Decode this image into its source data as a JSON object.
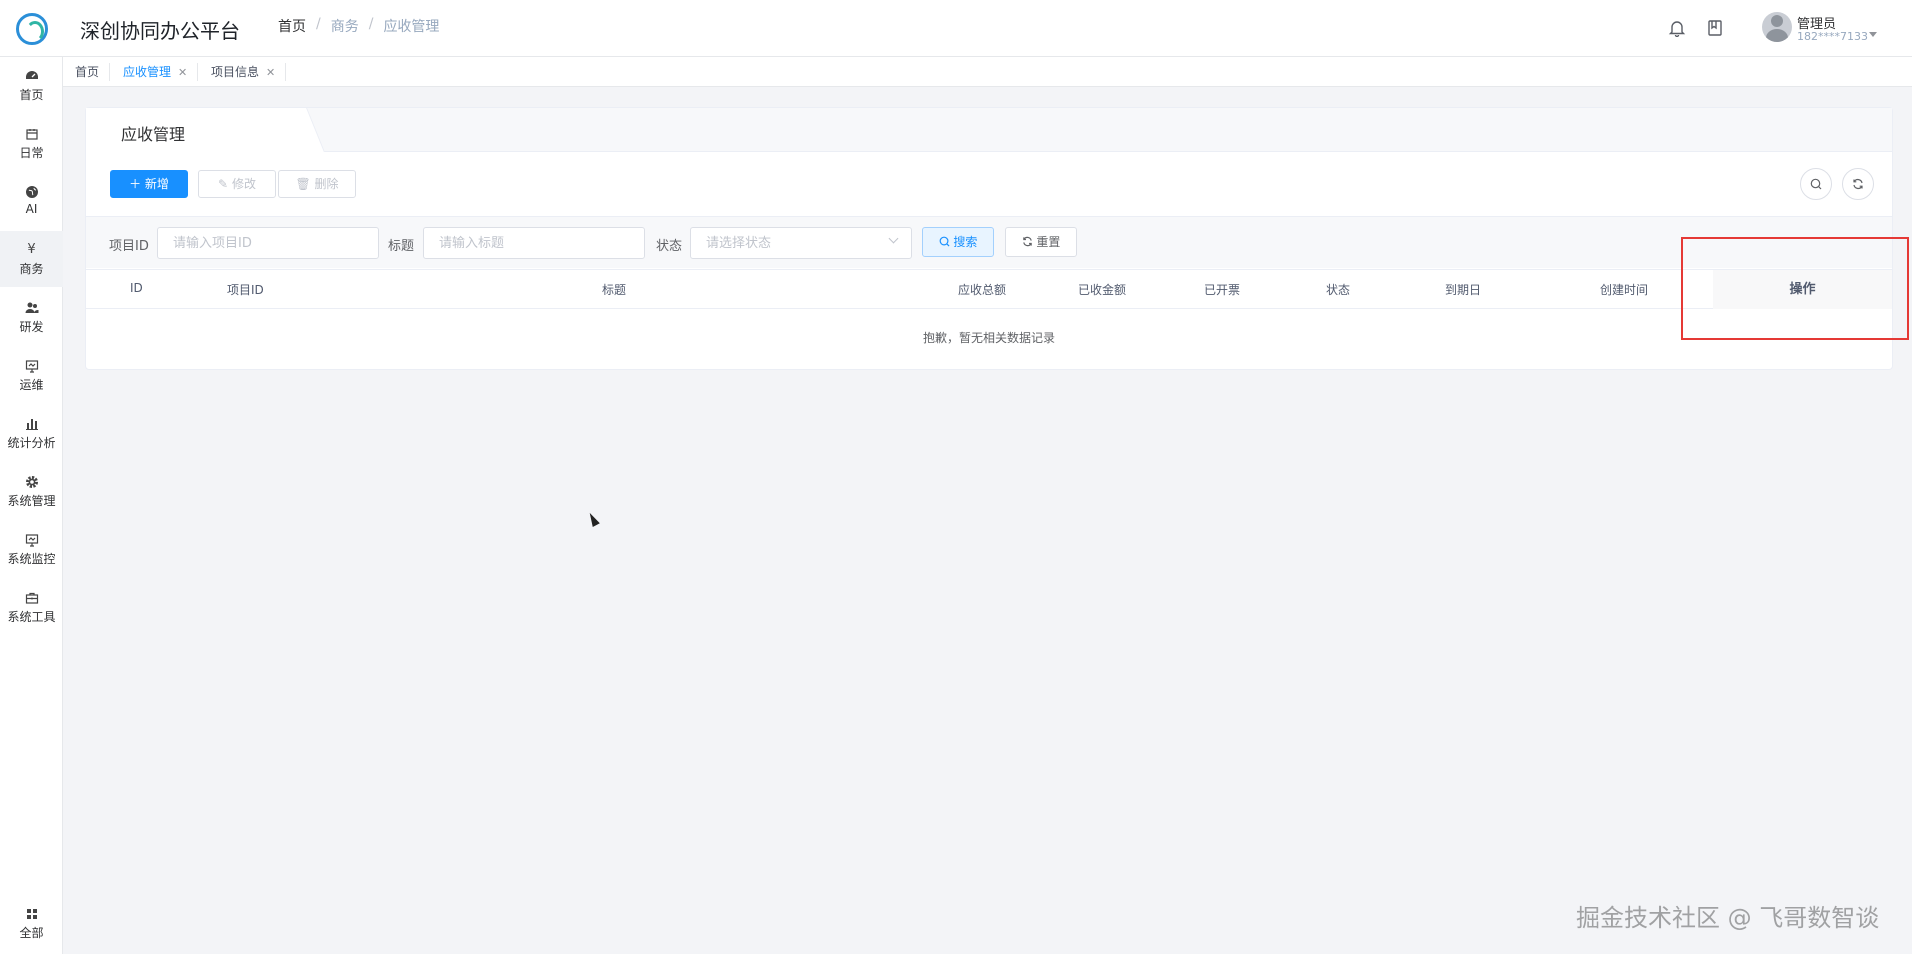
{
  "header": {
    "app_title": "深创协同办公平台",
    "breadcrumb": [
      "首页",
      "商务",
      "应收管理"
    ],
    "user": {
      "name": "管理员",
      "phone": "182****7133"
    },
    "icons": [
      "bell-icon",
      "book-icon"
    ]
  },
  "sidebar": {
    "items": [
      {
        "label": "首页",
        "icon": "dashboard-icon"
      },
      {
        "label": "日常",
        "icon": "calendar-icon"
      },
      {
        "label": "AI",
        "icon": "globe-icon"
      },
      {
        "label": "商务",
        "icon": "yen-icon"
      },
      {
        "label": "研发",
        "icon": "users-icon"
      },
      {
        "label": "运维",
        "icon": "monitor-icon"
      },
      {
        "label": "统计分析",
        "icon": "chart-icon"
      },
      {
        "label": "系统管理",
        "icon": "gear-icon"
      },
      {
        "label": "系统监控",
        "icon": "monitor-icon"
      },
      {
        "label": "系统工具",
        "icon": "toolbox-icon"
      }
    ],
    "bottom": {
      "label": "全部",
      "icon": "grid-icon"
    },
    "active": "商务"
  },
  "tags": [
    {
      "label": "首页",
      "closable": false
    },
    {
      "label": "应收管理",
      "closable": true,
      "active": true
    },
    {
      "label": "项目信息",
      "closable": true
    }
  ],
  "card": {
    "tab_label": "应收管理",
    "toolbar": {
      "add_label": "新增",
      "edit_label": "修改",
      "delete_label": "删除"
    },
    "filters": {
      "project_id_label": "项目ID",
      "project_id_placeholder": "请输入项目ID",
      "title_label": "标题",
      "title_placeholder": "请输入标题",
      "status_label": "状态",
      "status_placeholder": "请选择状态",
      "search_label": "搜索",
      "reset_label": "重置"
    },
    "table": {
      "columns": [
        "ID",
        "项目ID",
        "标题",
        "应收总额",
        "已收金额",
        "已开票",
        "状态",
        "到期日",
        "创建时间"
      ],
      "action_column": "操作",
      "empty_text": "抱歉，暂无相关数据记录"
    }
  },
  "watermark": "掘金技术社区 @ 飞哥数智谈",
  "colors": {
    "primary": "#1890ff",
    "highlight": "#e53935"
  }
}
